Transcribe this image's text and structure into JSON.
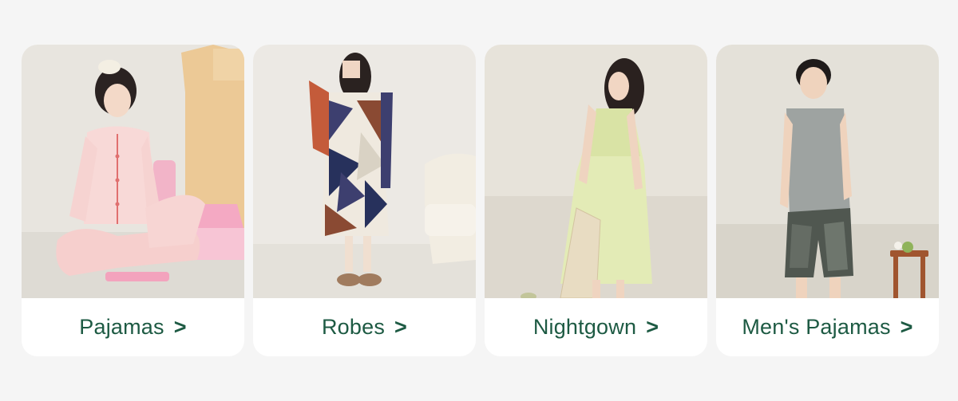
{
  "categories": [
    {
      "label": "Pajamas",
      "arrow": ">",
      "bg": "#e9e6e0"
    },
    {
      "label": "Robes",
      "arrow": ">",
      "bg": "#ebe9e5"
    },
    {
      "label": "Nightgown",
      "arrow": ">",
      "bg": "#e6e2d9"
    },
    {
      "label": "Men's Pajamas",
      "arrow": ">",
      "bg": "#e4e1d9"
    }
  ],
  "accent_text_color": "#1d5a43"
}
